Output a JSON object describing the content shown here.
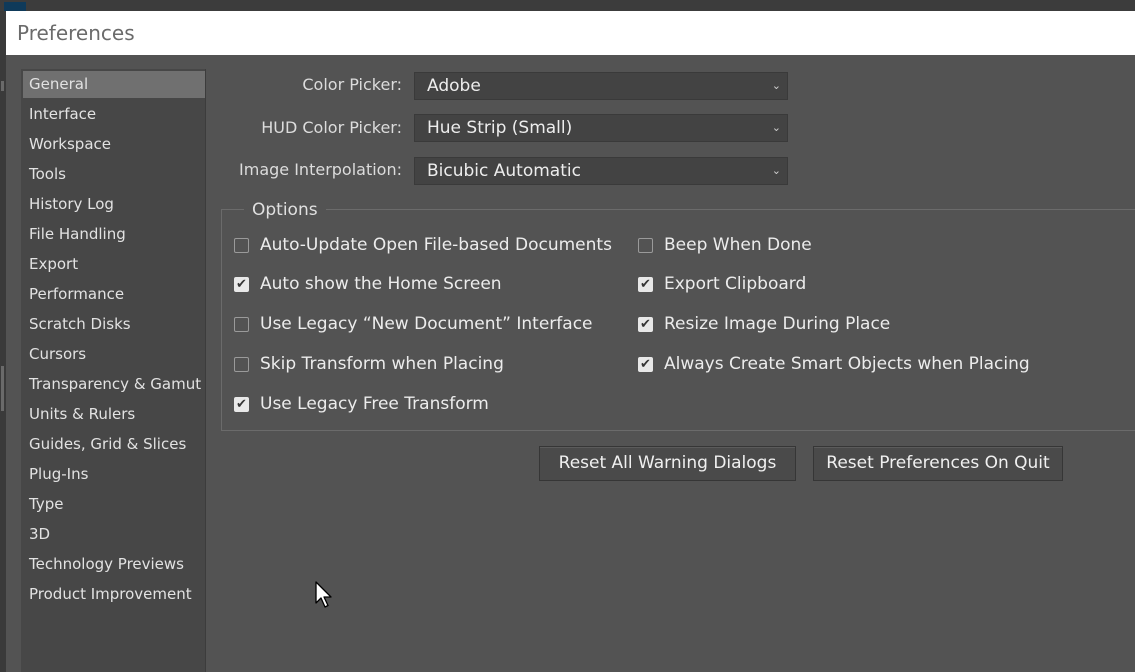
{
  "dialog": {
    "title": "Preferences"
  },
  "sidebar": {
    "items": [
      {
        "label": "General",
        "selected": true
      },
      {
        "label": "Interface",
        "selected": false
      },
      {
        "label": "Workspace",
        "selected": false
      },
      {
        "label": "Tools",
        "selected": false
      },
      {
        "label": "History Log",
        "selected": false
      },
      {
        "label": "File Handling",
        "selected": false
      },
      {
        "label": "Export",
        "selected": false
      },
      {
        "label": "Performance",
        "selected": false
      },
      {
        "label": "Scratch Disks",
        "selected": false
      },
      {
        "label": "Cursors",
        "selected": false
      },
      {
        "label": "Transparency & Gamut",
        "selected": false
      },
      {
        "label": "Units & Rulers",
        "selected": false
      },
      {
        "label": "Guides, Grid & Slices",
        "selected": false
      },
      {
        "label": "Plug-Ins",
        "selected": false
      },
      {
        "label": "Type",
        "selected": false
      },
      {
        "label": "3D",
        "selected": false
      },
      {
        "label": "Technology Previews",
        "selected": false
      },
      {
        "label": "Product Improvement",
        "selected": false
      }
    ]
  },
  "fields": {
    "color_picker": {
      "label": "Color Picker:",
      "value": "Adobe"
    },
    "hud_color_picker": {
      "label": "HUD Color Picker:",
      "value": "Hue Strip (Small)"
    },
    "image_interpolation": {
      "label": "Image Interpolation:",
      "value": "Bicubic Automatic"
    }
  },
  "options": {
    "legend": "Options",
    "left": [
      {
        "label": "Auto-Update Open File-based Documents",
        "checked": false
      },
      {
        "label": "Auto show the Home Screen",
        "checked": true
      },
      {
        "label": "Use Legacy “New Document” Interface",
        "checked": false
      },
      {
        "label": "Skip Transform when Placing",
        "checked": false
      },
      {
        "label": "Use Legacy Free Transform",
        "checked": true
      }
    ],
    "right": [
      {
        "label": "Beep When Done",
        "checked": false
      },
      {
        "label": "Export Clipboard",
        "checked": true
      },
      {
        "label": "Resize Image During Place",
        "checked": true
      },
      {
        "label": "Always Create Smart Objects when Placing",
        "checked": true
      }
    ]
  },
  "buttons": {
    "reset_warnings": "Reset All Warning Dialogs",
    "reset_prefs": "Reset Preferences On Quit"
  },
  "icons": {
    "dropdown": "chevron-down-icon",
    "check": "checkmark-icon",
    "cursor": "mouse-pointer-icon"
  }
}
